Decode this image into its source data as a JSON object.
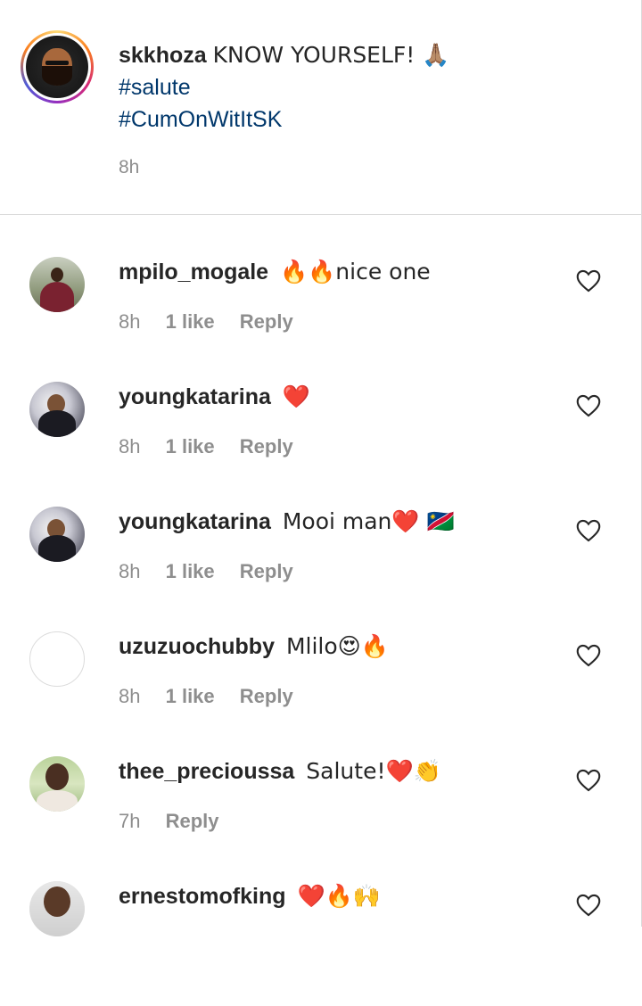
{
  "caption": {
    "username": "skkhoza",
    "text": "KNOW YOURSELF! 🙏🏽",
    "hashtags": [
      "#salute",
      "#CumOnWitItSK"
    ],
    "time": "8h"
  },
  "comments": [
    {
      "username": "mpilo_mogale",
      "text": "🔥🔥nice one",
      "time": "8h",
      "likes": "1 like",
      "reply": "Reply"
    },
    {
      "username": "youngkatarina",
      "text": "❤️",
      "time": "8h",
      "likes": "1 like",
      "reply": "Reply"
    },
    {
      "username": "youngkatarina",
      "text": "Mooi man❤️ 🇳🇦",
      "time": "8h",
      "likes": "1 like",
      "reply": "Reply"
    },
    {
      "username": "uzuzuochubby",
      "text": "Mlilo😍🔥",
      "time": "8h",
      "likes": "1 like",
      "reply": "Reply"
    },
    {
      "username": "thee_precioussa",
      "text": "Salute!❤️👏",
      "time": "7h",
      "reply": "Reply"
    },
    {
      "username": "ernestomofking",
      "text": "❤️🔥🙌"
    }
  ],
  "icons": {
    "like": "heart-outline-icon"
  },
  "colors": {
    "hashtag": "#00376b",
    "muted": "#8e8e8e",
    "divider": "#dbdbdb"
  }
}
